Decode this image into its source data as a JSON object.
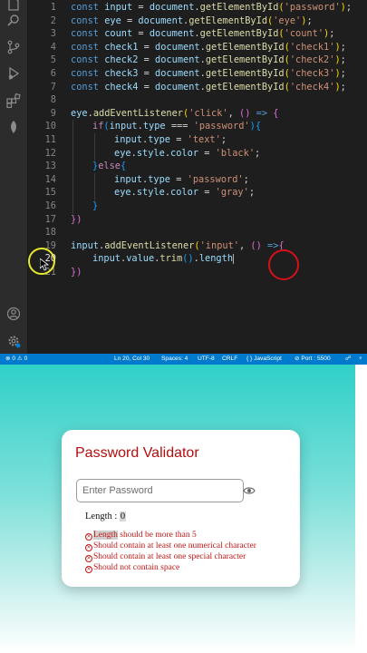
{
  "editor": {
    "line_numbers": [
      "1",
      "2",
      "3",
      "4",
      "5",
      "6",
      "7",
      "8",
      "9",
      "10",
      "11",
      "12",
      "13",
      "14",
      "15",
      "16",
      "17",
      "18",
      "19",
      "20",
      "21"
    ],
    "active_line": "20",
    "code": {
      "l1": {
        "kw": "const",
        "name": " input",
        "eq": " = ",
        "obj": "document",
        "dot": ".",
        "fn": "getElementById",
        "open": "(",
        "str": "'password'",
        "close": ")",
        "semi": ";"
      },
      "l2": {
        "kw": "const",
        "name": " eye",
        "eq": " = ",
        "obj": "document",
        "dot": ".",
        "fn": "getElementById",
        "open": "(",
        "str": "'eye'",
        "close": ")",
        "semi": ";"
      },
      "l3": {
        "kw": "const",
        "name": " count",
        "eq": " = ",
        "obj": "document",
        "dot": ".",
        "fn": "getElementById",
        "open": "(",
        "str": "'count'",
        "close": ")",
        "semi": ";"
      },
      "l4": {
        "kw": "const",
        "name": " check1",
        "eq": " = ",
        "obj": "document",
        "dot": ".",
        "fn": "getElementById",
        "open": "(",
        "str": "'check1'",
        "close": ")",
        "semi": ";"
      },
      "l5": {
        "kw": "const",
        "name": " check2",
        "eq": " = ",
        "obj": "document",
        "dot": ".",
        "fn": "getElementById",
        "open": "(",
        "str": "'check2'",
        "close": ")",
        "semi": ";"
      },
      "l6": {
        "kw": "const",
        "name": " check3",
        "eq": " = ",
        "obj": "document",
        "dot": ".",
        "fn": "getElementById",
        "open": "(",
        "str": "'check3'",
        "close": ")",
        "semi": ";"
      },
      "l7": {
        "kw": "const",
        "name": " check4",
        "eq": " = ",
        "obj": "document",
        "dot": ".",
        "fn": "getElementById",
        "open": "(",
        "str": "'check4'",
        "close": ")",
        "semi": ";"
      },
      "l9": {
        "obj": "eye",
        "dot": ".",
        "fn": "addEventListener",
        "open": "(",
        "str": "'click'",
        "comma": ", ",
        "args": "() ",
        "arrow": "=>",
        "brace": " {"
      },
      "l10": {
        "kw": "if",
        "open": "(",
        "obj": "input",
        "dot": ".",
        "prop": "type",
        "op": " === ",
        "str": "'password'",
        "close": ")",
        "brace": "{"
      },
      "l11": {
        "obj": "input",
        "dot": ".",
        "prop": "type",
        "eq": " = ",
        "str": "'text'",
        "semi": ";"
      },
      "l12": {
        "obj": "eye",
        "dot": ".",
        "prop": "style",
        "dot2": ".",
        "prop2": "color",
        "eq": " = ",
        "str": "'black'",
        "semi": ";"
      },
      "l13": {
        "brace": "}",
        "kw": "else",
        "brace2": "{"
      },
      "l14": {
        "obj": "input",
        "dot": ".",
        "prop": "type",
        "eq": " = ",
        "str": "'password'",
        "semi": ";"
      },
      "l15": {
        "obj": "eye",
        "dot": ".",
        "prop": "style",
        "dot2": ".",
        "prop2": "color",
        "eq": " = ",
        "str": "'gray'",
        "semi": ";"
      },
      "l16": {
        "brace": "}"
      },
      "l18": {
        "brace": "})"
      },
      "l20": {
        "obj": "input",
        "dot": ".",
        "fn": "addEventListener",
        "open": "(",
        "str": "'input'",
        "comma": ", ",
        "args": "() ",
        "arrow": "=>",
        "brace": "{"
      },
      "l21": {
        "obj": "input",
        "dot": ".",
        "prop": "value",
        "dot2": ".",
        "fn": "trim",
        "call": "()",
        "dot3": ".",
        "prop2": "length"
      },
      "l22": {
        "brace": "})"
      }
    }
  },
  "statusbar": {
    "errors": "⊗ 0 ⚠ 0",
    "position": "Ln 20, Col 30",
    "spaces": "Spaces: 4",
    "encoding": "UTF-8",
    "eol": "CRLF",
    "language": "{ } JavaScript",
    "port": "⊘ Port : 5500"
  },
  "preview": {
    "title": "Password Validator",
    "input_placeholder": "Enter Password",
    "length_label": "Length : ",
    "length_value": "0",
    "rules": [
      {
        "first": "Length",
        "rest": " should be more than 5"
      },
      {
        "first": "Should contain at least one numerical character",
        "rest": ""
      },
      {
        "first": "Should contain at least one special character",
        "rest": ""
      },
      {
        "first": "Should not contain space",
        "rest": ""
      }
    ]
  },
  "colors": {
    "accent": "#007acc",
    "title_red": "#b20e0e",
    "rule_red": "#c21717"
  },
  "icons": [
    "files-icon",
    "search-icon",
    "source-control-icon",
    "run-debug-icon",
    "extensions-icon",
    "leaf-icon",
    "account-icon",
    "settings-gear-icon",
    "eye-icon",
    "error-circle-icon",
    "warning-icon",
    "broadcast-icon"
  ]
}
